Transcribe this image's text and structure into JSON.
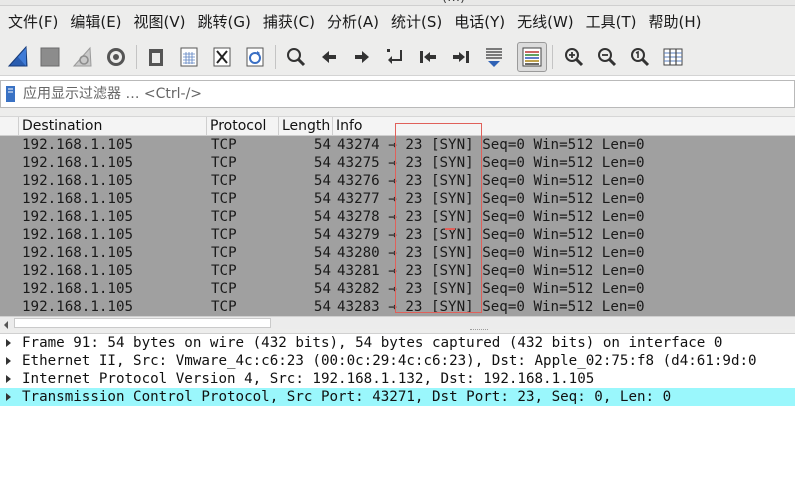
{
  "window": {
    "title_fragment": "(…)"
  },
  "menu": [
    "文件(F)",
    "编辑(E)",
    "视图(V)",
    "跳转(G)",
    "捕获(C)",
    "分析(A)",
    "统计(S)",
    "电话(Y)",
    "无线(W)",
    "工具(T)",
    "帮助(H)"
  ],
  "toolbar": {
    "icons": [
      "shark-fin-start-icon",
      "stop-square-icon",
      "restart-fin-icon",
      "capture-options-gear-icon",
      "open-file-icon",
      "save-file-icon",
      "close-file-icon",
      "reload-file-icon",
      "find-packet-icon",
      "go-back-icon",
      "go-forward-icon",
      "go-to-packet-icon",
      "first-packet-icon",
      "last-packet-icon",
      "autoscroll-icon",
      "colorize-icon",
      "zoom-in-icon",
      "zoom-out-icon",
      "zoom-reset-icon",
      "resize-columns-icon"
    ]
  },
  "filter": {
    "placeholder": "应用显示过滤器 … <Ctrl-/>",
    "value": ""
  },
  "packet_list": {
    "columns": [
      "Destination",
      "Protocol",
      "Length",
      "Info"
    ],
    "rows": [
      {
        "destination": "192.168.1.105",
        "protocol": "TCP",
        "length": "54",
        "info": "43274 → 23 [SYN] Seq=0 Win=512 Len=0"
      },
      {
        "destination": "192.168.1.105",
        "protocol": "TCP",
        "length": "54",
        "info": "43275 → 23 [SYN] Seq=0 Win=512 Len=0"
      },
      {
        "destination": "192.168.1.105",
        "protocol": "TCP",
        "length": "54",
        "info": "43276 → 23 [SYN] Seq=0 Win=512 Len=0"
      },
      {
        "destination": "192.168.1.105",
        "protocol": "TCP",
        "length": "54",
        "info": "43277 → 23 [SYN] Seq=0 Win=512 Len=0"
      },
      {
        "destination": "192.168.1.105",
        "protocol": "TCP",
        "length": "54",
        "info": "43278 → 23 [SYN] Seq=0 Win=512 Len=0"
      },
      {
        "destination": "192.168.1.105",
        "protocol": "TCP",
        "length": "54",
        "info": "43279 → 23 [SYN] Seq=0 Win=512 Len=0"
      },
      {
        "destination": "192.168.1.105",
        "protocol": "TCP",
        "length": "54",
        "info": "43280 → 23 [SYN] Seq=0 Win=512 Len=0"
      },
      {
        "destination": "192.168.1.105",
        "protocol": "TCP",
        "length": "54",
        "info": "43281 → 23 [SYN] Seq=0 Win=512 Len=0"
      },
      {
        "destination": "192.168.1.105",
        "protocol": "TCP",
        "length": "54",
        "info": "43282 → 23 [SYN] Seq=0 Win=512 Len=0"
      },
      {
        "destination": "192.168.1.105",
        "protocol": "TCP",
        "length": "54",
        "info": "43283 → 23 [SYN] Seq=0 Win=512 Len=0"
      }
    ],
    "row_color": "#a0a0a0"
  },
  "annotation": {
    "color": "#e0605a"
  },
  "details": {
    "rows": [
      {
        "text": "Frame 91: 54 bytes on wire (432 bits), 54 bytes captured (432 bits) on interface 0",
        "selected": false
      },
      {
        "text": "Ethernet II, Src: Vmware_4c:c6:23 (00:0c:29:4c:c6:23), Dst: Apple_02:75:f8 (d4:61:9d:0",
        "selected": false
      },
      {
        "text": "Internet Protocol Version 4, Src: 192.168.1.132, Dst: 192.168.1.105",
        "selected": false
      },
      {
        "text": "Transmission Control Protocol, Src Port: 43271, Dst Port: 23, Seq: 0, Len: 0",
        "selected": true
      }
    ],
    "selected_color": "#9af7fc"
  }
}
